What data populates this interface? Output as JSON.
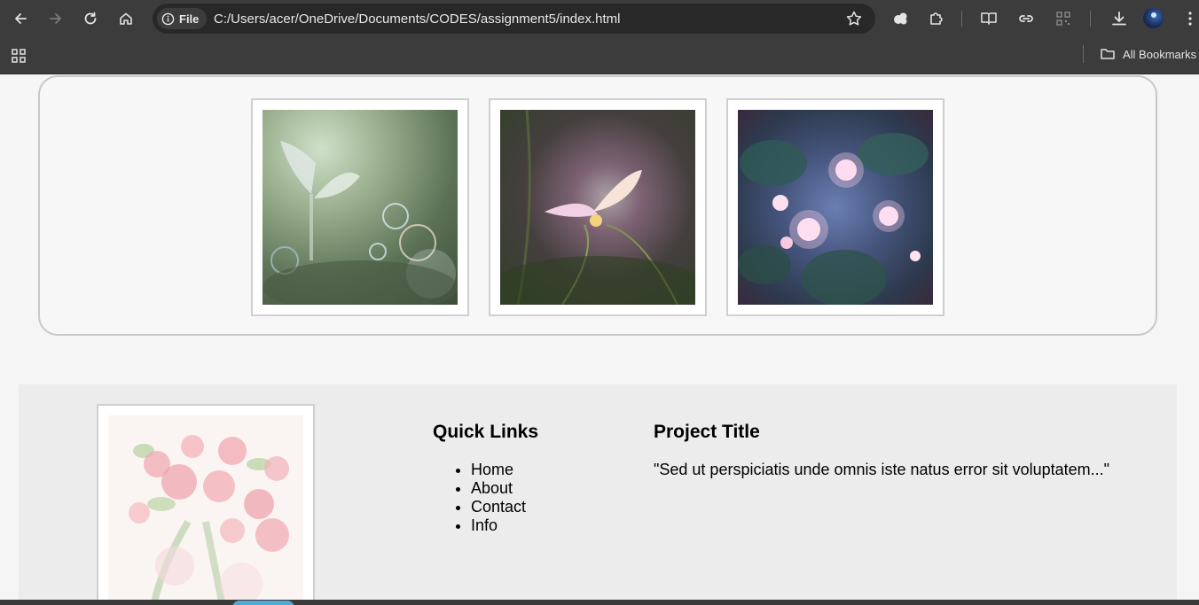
{
  "browser": {
    "address_chip_label": "File",
    "url": "C:/Users/acer/OneDrive/Documents/CODES/assignment5/index.html",
    "bookmarks_folder_label": "All Bookmarks"
  },
  "gallery": {
    "images": [
      {
        "subject": "glowing butterfly among soap bubbles"
      },
      {
        "subject": "pink butterfly on a flower at dusk"
      },
      {
        "subject": "glowing pink flowers on lily pads"
      }
    ]
  },
  "footer": {
    "image": {
      "subject": "watercolor pink roses bouquet"
    },
    "quick_links": {
      "title": "Quick Links",
      "items": [
        "Home",
        "About",
        "Contact",
        "Info"
      ]
    },
    "project": {
      "title": "Project Title",
      "quote": "\"Sed ut perspiciatis unde omnis iste natus error sit voluptatem...\""
    }
  },
  "colors": {
    "chrome_bg": "#3c3c3c",
    "omnibox_bg": "#282828",
    "page_bg": "#f5f5f5",
    "footer_bg": "#ececec",
    "border": "#c8c8c8"
  }
}
